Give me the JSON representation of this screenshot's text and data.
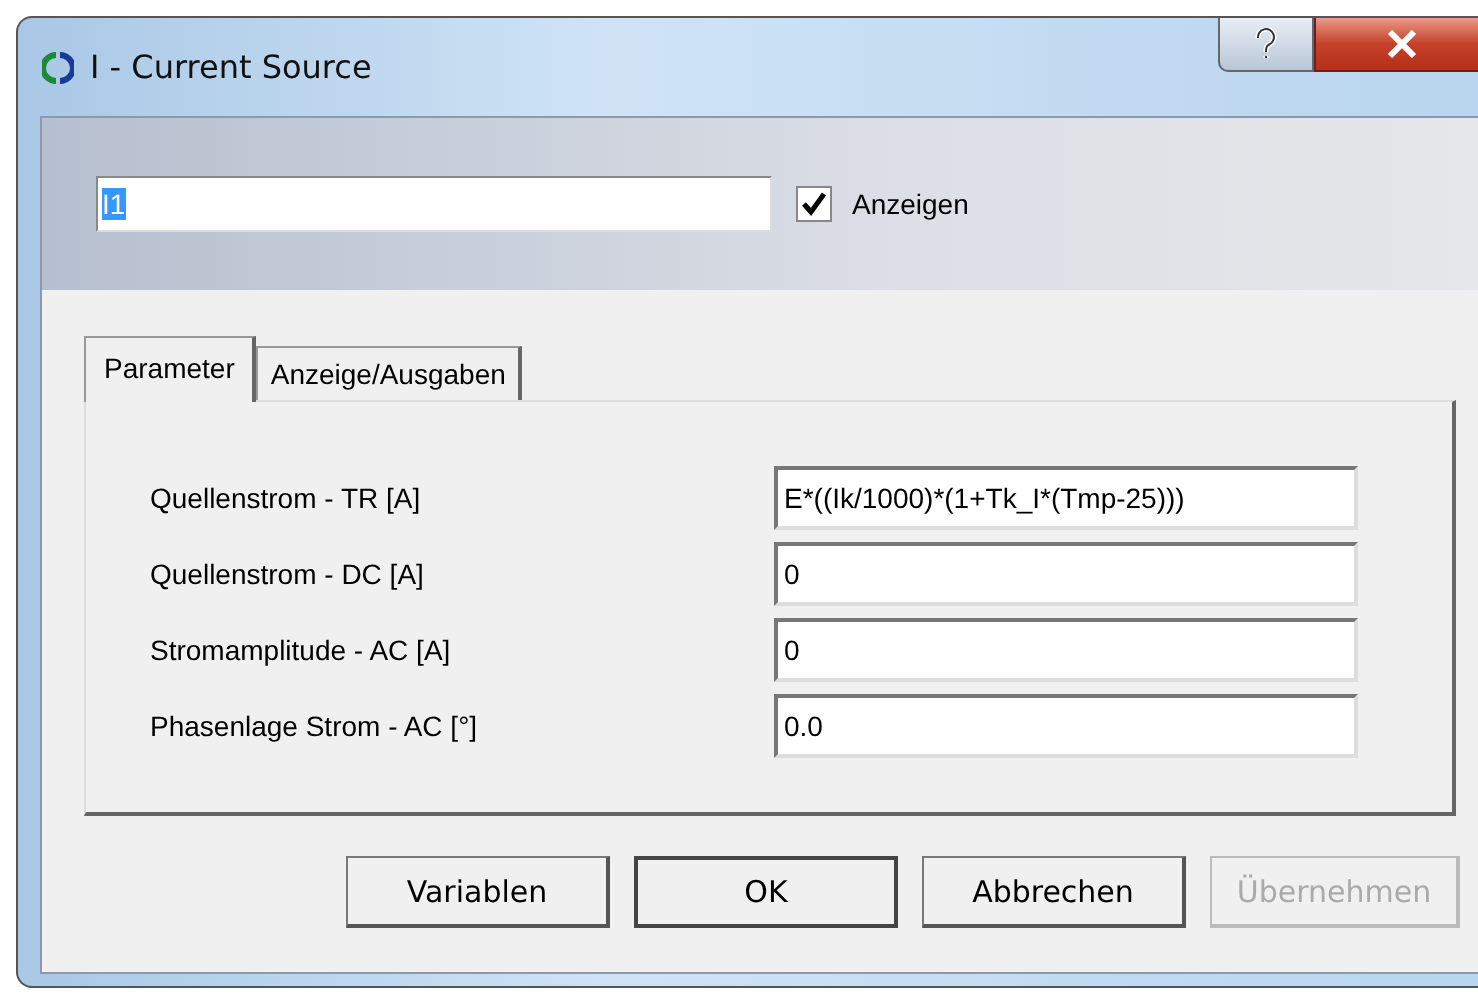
{
  "window": {
    "title": "I - Current Source"
  },
  "name_field": {
    "value": "I1",
    "text_selected": true
  },
  "show_checkbox": {
    "label": "Anzeigen",
    "checked": true
  },
  "tabs": [
    {
      "label": "Parameter",
      "selected": true
    },
    {
      "label": "Anzeige/Ausgaben",
      "selected": false
    }
  ],
  "parameters": [
    {
      "label": "Quellenstrom - TR [A]",
      "value": "E*((Ik/1000)*(1+Tk_I*(Tmp-25)))"
    },
    {
      "label": "Quellenstrom - DC [A]",
      "value": "0"
    },
    {
      "label": "Stromamplitude - AC [A]",
      "value": "0"
    },
    {
      "label": "Phasenlage Strom - AC [°]",
      "value": "0.0"
    }
  ],
  "buttons": [
    {
      "label": "Variablen",
      "disabled": false,
      "default": false
    },
    {
      "label": "OK",
      "disabled": false,
      "default": true
    },
    {
      "label": "Abbrechen",
      "disabled": false,
      "default": false
    },
    {
      "label": "Übernehmen",
      "disabled": true,
      "default": false
    }
  ]
}
